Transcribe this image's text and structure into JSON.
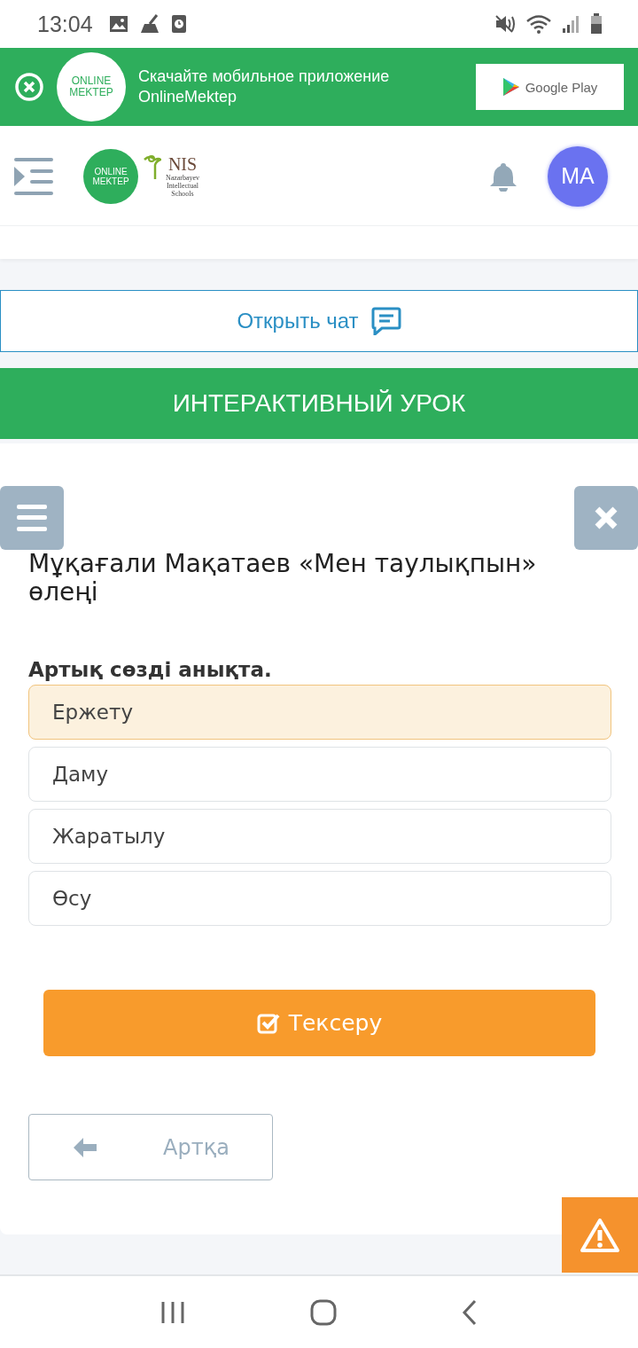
{
  "status_bar": {
    "time": "13:04"
  },
  "app_banner": {
    "logo": [
      "ONLINE",
      "MEKTEP"
    ],
    "message": "Скачайте мобильное приложение OnlineMektep",
    "store_button": "Google Play"
  },
  "header": {
    "logo": [
      "ONLINE",
      "MEKTEP"
    ],
    "partner_logo": {
      "name": "NIS",
      "subtitle": "Nazarbayev Intellectual Schools"
    },
    "avatar": "MA"
  },
  "chat_button": "Открыть чат",
  "lesson_bar": "ИНТЕРАКТИВНЫЙ УРОК",
  "lesson": {
    "title": "Мұқағали Мақатаев «Мен таулықпын» өлеңі",
    "question": "Артық сөзді анықта.",
    "options": [
      {
        "label": "Ержету",
        "selected": true
      },
      {
        "label": "Даму",
        "selected": false
      },
      {
        "label": "Жаратылу",
        "selected": false
      },
      {
        "label": "Өсу",
        "selected": false
      }
    ],
    "check_button": "Тексеру",
    "back_button": "Артқа"
  }
}
